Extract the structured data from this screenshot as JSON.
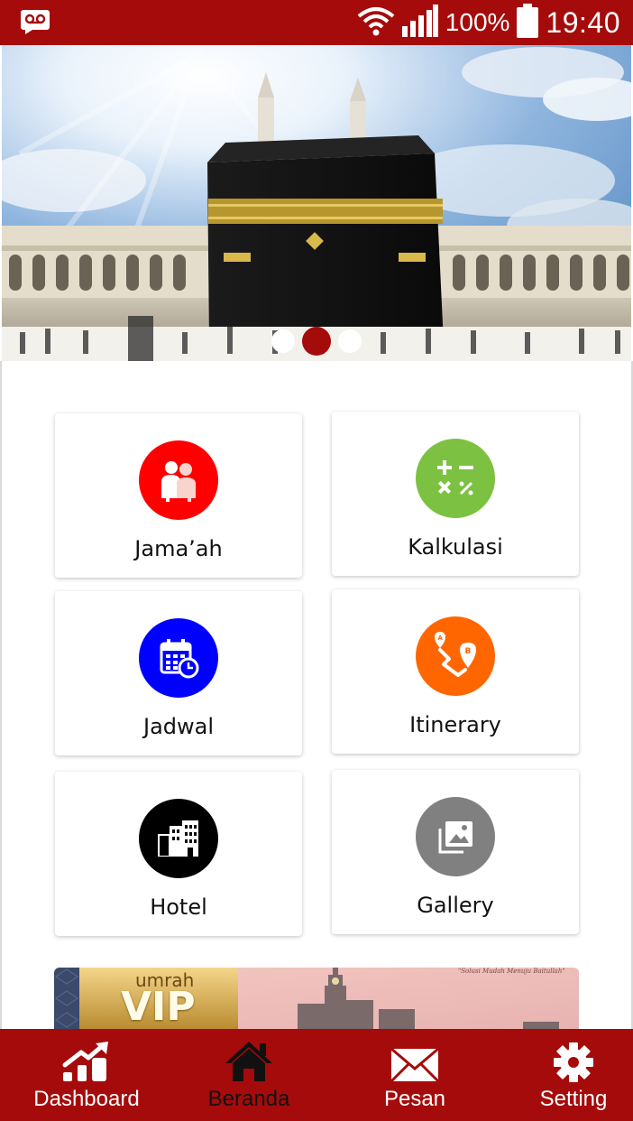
{
  "status_bar": {
    "battery": "100%",
    "time": "19:40",
    "icons": [
      "voicemail-icon",
      "wifi-icon",
      "signal-icon",
      "battery-icon"
    ]
  },
  "hero": {
    "slides_total": 3,
    "active_slide": 2
  },
  "menu": [
    {
      "label": "Jama’ah",
      "icon": "people-icon",
      "color": "#ff0000"
    },
    {
      "label": "Kalkulasi",
      "icon": "calculator-icon",
      "color": "#7cc142"
    },
    {
      "label": "Jadwal",
      "icon": "calendar-icon",
      "color": "#0000ff"
    },
    {
      "label": "Itinerary",
      "icon": "route-icon",
      "color": "#ff6600"
    },
    {
      "label": "Hotel",
      "icon": "building-icon",
      "color": "#000000"
    },
    {
      "label": "Gallery",
      "icon": "gallery-icon",
      "color": "#808080"
    }
  ],
  "promo": {
    "brand_top": "umrah",
    "brand_main": "VIP",
    "tagline": "\"Solusi Mudah Menuju Baitullah\""
  },
  "bottom_nav": [
    {
      "label": "Dashboard",
      "icon": "chart-up-icon",
      "active": false
    },
    {
      "label": "Beranda",
      "icon": "home-icon",
      "active": true
    },
    {
      "label": "Pesan",
      "icon": "mail-icon",
      "active": false
    },
    {
      "label": "Setting",
      "icon": "gear-icon",
      "active": false
    }
  ],
  "colors": {
    "primary": "#a50b0b",
    "background": "#ffffff",
    "active_nav_text": "#111111"
  }
}
